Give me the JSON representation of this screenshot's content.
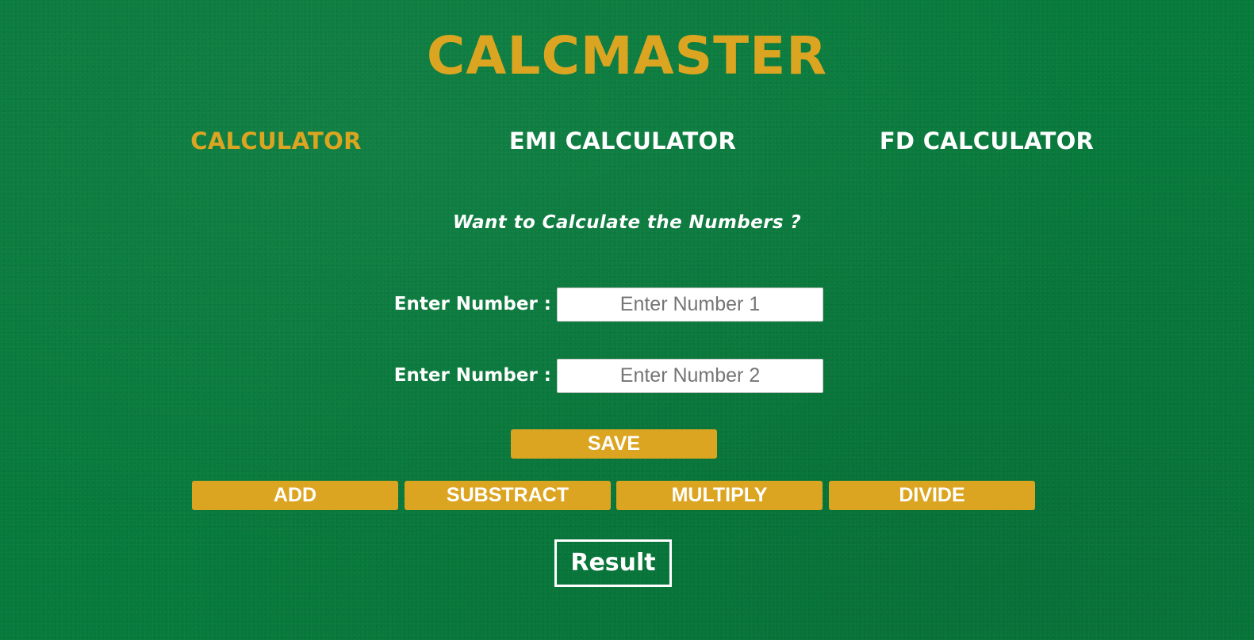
{
  "app": {
    "title": "CALCMASTER"
  },
  "nav": {
    "items": [
      {
        "label": "CALCULATOR",
        "active": true
      },
      {
        "label": "EMI CALCULATOR",
        "active": false
      },
      {
        "label": "FD CALCULATOR",
        "active": false
      }
    ]
  },
  "main": {
    "tagline": "Want to Calculate the Numbers ?",
    "fields": [
      {
        "label": "Enter Number :",
        "placeholder": "Enter Number 1",
        "value": ""
      },
      {
        "label": "Enter Number :",
        "placeholder": "Enter Number 2",
        "value": ""
      }
    ],
    "save_label": "SAVE",
    "operations": [
      {
        "label": "ADD"
      },
      {
        "label": "SUBSTRACT"
      },
      {
        "label": "MULTIPLY"
      },
      {
        "label": "DIVIDE"
      }
    ],
    "result_label": "Result"
  },
  "colors": {
    "background": "#087a3c",
    "accent": "#dca521",
    "text": "#ffffff"
  }
}
